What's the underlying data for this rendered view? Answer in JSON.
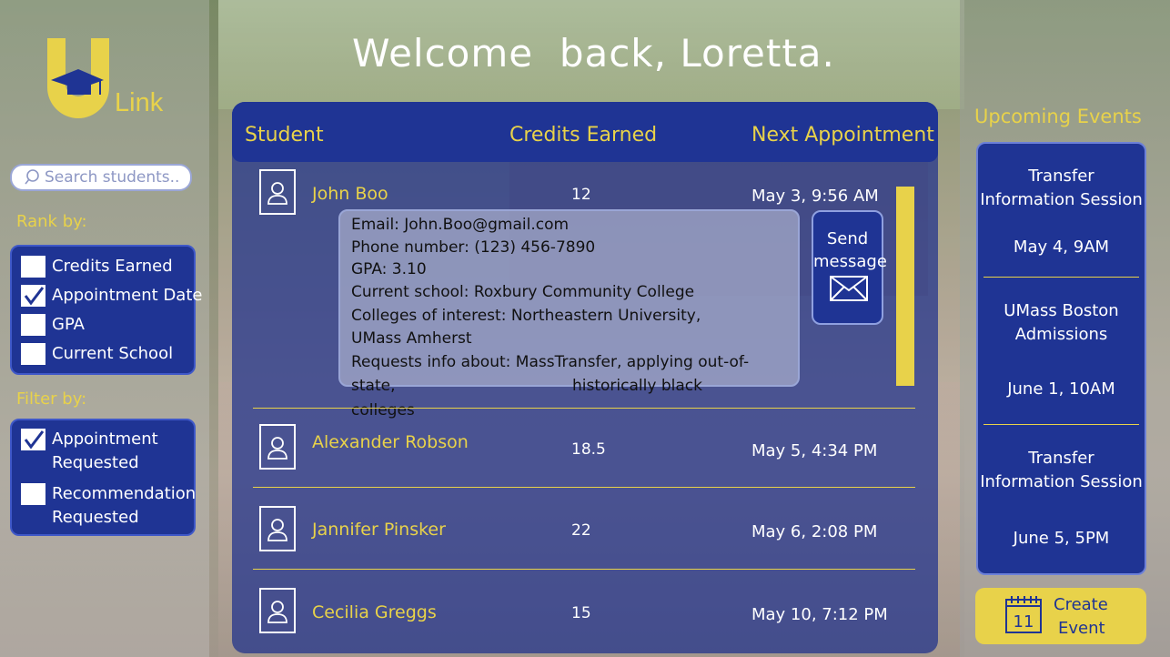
{
  "app": {
    "logo_text": "Link",
    "welcome": "Welcome  back, Loretta."
  },
  "sidebar": {
    "search_placeholder": "Search students..",
    "rank_label": "Rank by:",
    "rank_options": [
      {
        "label": "Credits Earned",
        "checked": false
      },
      {
        "label": "Appointment Date",
        "checked": true
      },
      {
        "label": "GPA",
        "checked": false
      },
      {
        "label": "Current School",
        "checked": false
      }
    ],
    "filter_label": "Filter by:",
    "filter_options": [
      {
        "label_line1": "Appointment",
        "label_line2": "Requested",
        "checked": true
      },
      {
        "label_line1": "Recommendation",
        "label_line2": "Requested",
        "checked": false
      }
    ]
  },
  "table": {
    "headers": {
      "student": "Student",
      "credits": "Credits Earned",
      "appointment": "Next Appointment"
    },
    "rows": [
      {
        "name": "John Boo",
        "credits": "12",
        "appointment": "May 3, 9:56 AM"
      },
      {
        "name": "Alexander Robson",
        "credits": "18.5",
        "appointment": "May 5, 4:34 PM"
      },
      {
        "name": "Jannifer Pinsker",
        "credits": "22",
        "appointment": "May 6, 2:08 PM"
      },
      {
        "name": "Cecilia Greggs",
        "credits": "15",
        "appointment": "May 10, 7:12 PM"
      }
    ],
    "detail": {
      "lines": [
        "Email: John.Boo@gmail.com",
        "Phone number: (123) 456-7890",
        "GPA: 3.10",
        "Current school: Roxbury Community College",
        "Colleges of interest: Northeastern University,",
        "UMass Amherst",
        "Requests info about: MassTransfer, applying out-of-",
        "state,                                    historically black",
        "colleges"
      ]
    },
    "send_button": {
      "line1": "Send",
      "line2": "message"
    }
  },
  "events": {
    "title": "Upcoming Events",
    "items": [
      {
        "line1": "Transfer",
        "line2": "Information Session",
        "date": "May 4, 9AM"
      },
      {
        "line1": "UMass Boston",
        "line2": "Admissions",
        "date": "June 1, 10AM"
      },
      {
        "line1": "Transfer",
        "line2": "Information Session",
        "date": "June 5, 5PM"
      }
    ],
    "create_button": {
      "line1": "Create",
      "line2": "Event",
      "calendar_day": "11"
    }
  },
  "colors": {
    "navy": "#1f3494",
    "gold": "#e8d24a",
    "white": "#ffffff"
  }
}
